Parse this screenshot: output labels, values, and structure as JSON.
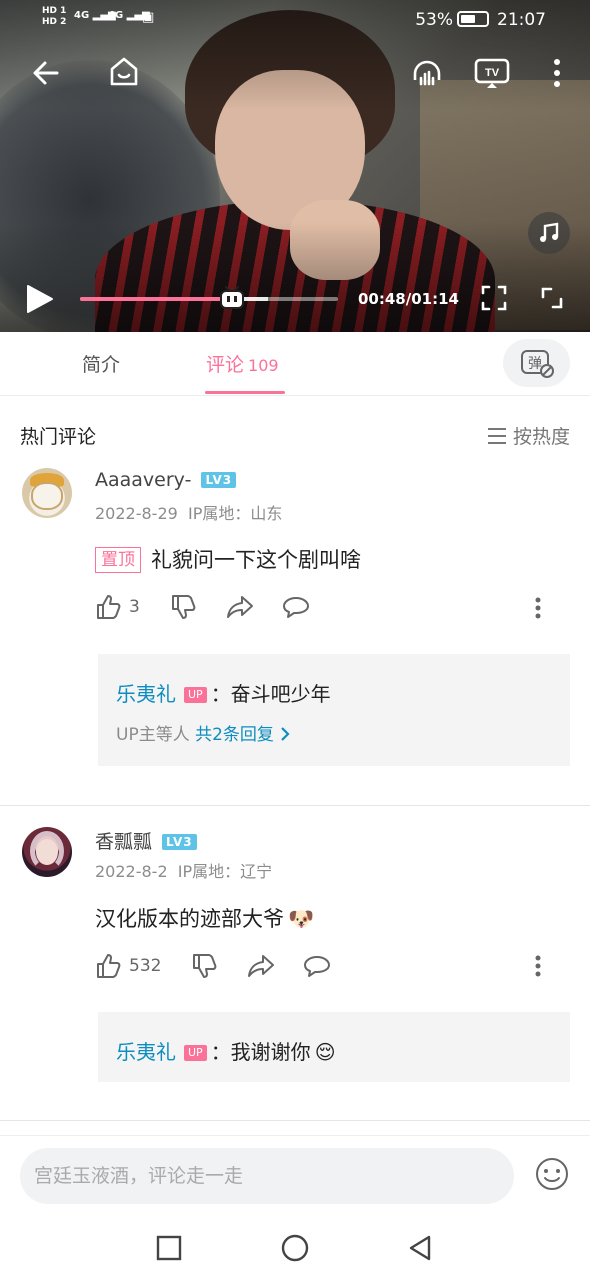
{
  "status_bar": {
    "sim1": "HD 1",
    "sim2": "HD 2",
    "net1": "4G",
    "net2": "4G",
    "battery": "53%",
    "time": "21:07"
  },
  "player": {
    "current_time": "00:48",
    "duration": "01:14",
    "time_display": "00:48/01:14",
    "progress": 0.59,
    "buffered": 0.73
  },
  "tabs": {
    "intro": "简介",
    "comments": "评论",
    "comments_count": "109"
  },
  "comments_section": {
    "title": "热门评论",
    "sort_label": "按热度"
  },
  "comments": [
    {
      "username": "Aaaavery-",
      "level": "LV3",
      "date": "2022-8-29",
      "ip_location": "IP属地：山东",
      "pinned_label": "置顶",
      "text": "礼貌问一下这个剧叫啥",
      "likes": "3",
      "reply": {
        "name": "乐夷礼",
        "badge": "UP",
        "text": "：奋斗吧少年",
        "more_prefix": "UP主等人",
        "more_link": "共2条回复"
      }
    },
    {
      "username": "香瓢瓢",
      "level": "LV3",
      "date": "2022-8-2",
      "ip_location": "IP属地：辽宁",
      "text": "汉化版本的迹部大爷",
      "emoji": "🐶",
      "likes": "532",
      "reply": {
        "name": "乐夷礼",
        "badge": "UP",
        "text": "：我谢谢你",
        "emoji": "😌"
      }
    }
  ],
  "input": {
    "placeholder": "宫廷玉液酒，评论走一走"
  },
  "colors": {
    "accent": "#fb7299",
    "link": "#0d8dbf",
    "level_badge": "#5fc3e8"
  }
}
